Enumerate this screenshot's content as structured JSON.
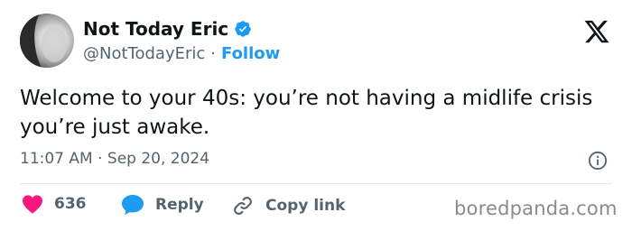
{
  "user": {
    "display_name": "Not Today Eric",
    "handle": "@NotTodayEric",
    "separator": "·",
    "follow_label": "Follow"
  },
  "tweet": {
    "text": "Welcome to your 40s: you’re not having a midlife crisis you’re just awake.",
    "timestamp": "11:07 AM · Sep 20, 2024"
  },
  "actions": {
    "likes_count": "636",
    "reply_label": "Reply",
    "copy_link_label": "Copy link"
  },
  "watermark": "boredpanda.com",
  "colors": {
    "accent": "#1d9bf0",
    "like": "#f91880",
    "text": "#0f1419",
    "muted": "#536471"
  },
  "icons": [
    "avatar",
    "verified-badge-icon",
    "x-logo-icon",
    "info-icon",
    "heart-icon",
    "reply-bubble-icon",
    "link-icon"
  ]
}
